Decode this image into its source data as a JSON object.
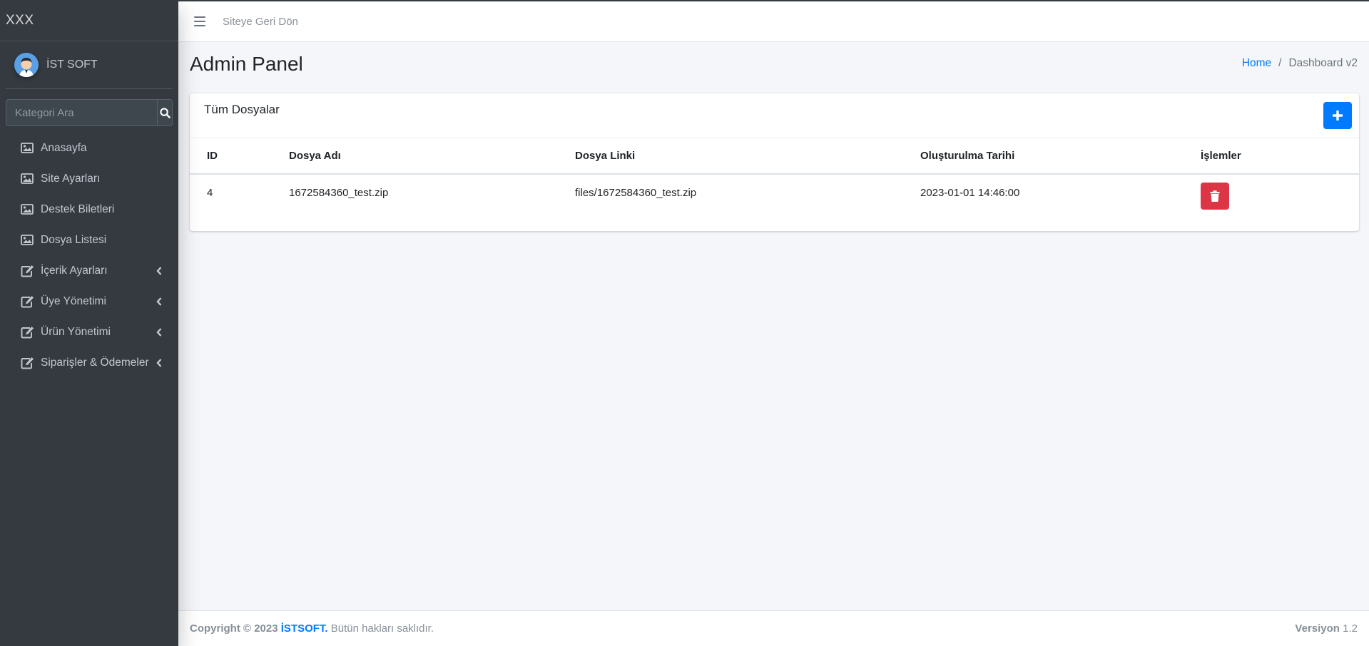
{
  "sidebar": {
    "brand": "XXX",
    "user_name": "İST SOFT",
    "search_placeholder": "Kategori Ara",
    "items": [
      {
        "label": "Anasayfa",
        "icon": "image-icon",
        "has_children": false
      },
      {
        "label": "Site Ayarları",
        "icon": "image-icon",
        "has_children": false
      },
      {
        "label": "Destek Biletleri",
        "icon": "image-icon",
        "has_children": false
      },
      {
        "label": "Dosya Listesi",
        "icon": "image-icon",
        "has_children": false
      },
      {
        "label": "İçerik Ayarları",
        "icon": "edit-icon",
        "has_children": true
      },
      {
        "label": "Üye Yönetimi",
        "icon": "edit-icon",
        "has_children": true
      },
      {
        "label": "Ürün Yönetimi",
        "icon": "edit-icon",
        "has_children": true
      },
      {
        "label": "Siparişler & Ödemeler",
        "icon": "edit-icon",
        "has_children": true
      }
    ]
  },
  "header": {
    "back_link": "Siteye Geri Dön"
  },
  "page": {
    "title": "Admin Panel",
    "breadcrumb_home": "Home",
    "breadcrumb_sep": "/",
    "breadcrumb_current": "Dashboard v2"
  },
  "card": {
    "title": "Tüm Dosyalar",
    "columns": [
      "ID",
      "Dosya Adı",
      "Dosya Linki",
      "Oluşturulma Tarihi",
      "İşlemler"
    ],
    "rows": [
      {
        "id": "4",
        "name": "1672584360_test.zip",
        "link": "files/1672584360_test.zip",
        "created": "2023-01-01 14:46:00"
      }
    ]
  },
  "footer": {
    "copyright_prefix": "Copyright © 2023",
    "company": "İSTSOFT.",
    "rights": " Bütün hakları saklıdır.",
    "version_label": "Versiyon",
    "version_value": " 1.2"
  },
  "colors": {
    "sidebar_bg": "#343a40",
    "primary": "#007bff",
    "danger": "#dc3545",
    "content_bg": "#f4f6f9"
  }
}
